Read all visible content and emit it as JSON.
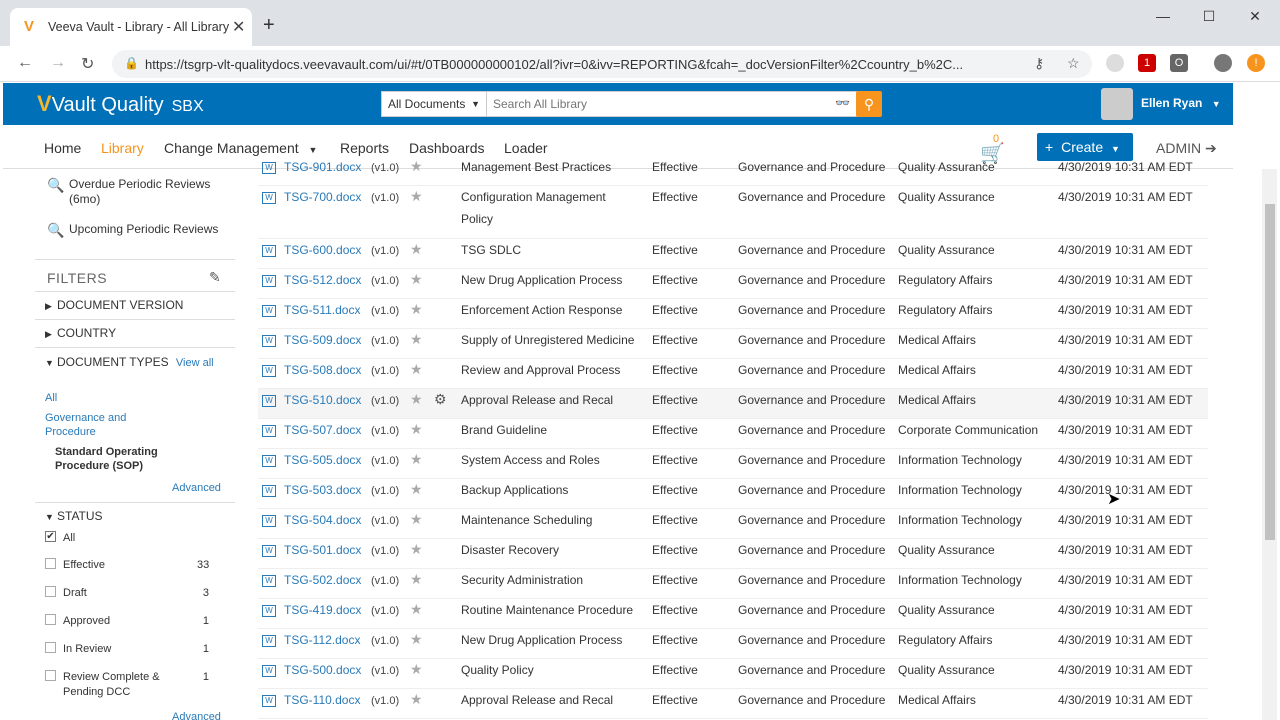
{
  "browser": {
    "tab_title": "Veeva Vault - Library - All Library",
    "url": "https://tsgrp-vlt-qualitydocs.veevavault.com/ui/#t/0TB000000000102/all?ivr=0&ivv=REPORTING&fcah=_docVersionFilter%2Ccountry_b%2C..."
  },
  "header": {
    "logo_text": "Vault Quality",
    "env_label": "SBX",
    "search_scope": "All Documents",
    "search_placeholder": "Search All Library",
    "user_name": "Ellen Ryan"
  },
  "nav": {
    "items": [
      "Home",
      "Library",
      "Change Management",
      "Reports",
      "Dashboards",
      "Loader"
    ],
    "active": "Library",
    "cart_count": "0",
    "create_label": "Create",
    "admin_label": "ADMIN"
  },
  "sidebar": {
    "saved_views": [
      "Overdue Periodic Reviews (6mo)",
      "Upcoming Periodic Reviews"
    ],
    "filters_label": "FILTERS",
    "facets": {
      "document_version": "DOCUMENT VERSION",
      "country": "COUNTRY",
      "document_types": "DOCUMENT TYPES",
      "view_all": "View all",
      "all": "All",
      "gov_proc": "Governance and Procedure",
      "sop": "Standard Operating Procedure (SOP)",
      "advanced": "Advanced",
      "status": "STATUS",
      "advanced2": "Advanced"
    },
    "status_options": [
      {
        "label": "All",
        "count": "",
        "checked": true
      },
      {
        "label": "Effective",
        "count": "33",
        "checked": false
      },
      {
        "label": "Draft",
        "count": "3",
        "checked": false
      },
      {
        "label": "Approved",
        "count": "1",
        "checked": false
      },
      {
        "label": "In Review",
        "count": "1",
        "checked": false
      },
      {
        "label": "Review Complete & Pending DCC",
        "count": "1",
        "checked": false
      }
    ]
  },
  "documents": [
    {
      "name": "TSG-901.docx",
      "version": "(v1.0)",
      "title": "Management Best Practices",
      "status": "Effective",
      "type": "Governance and Procedure",
      "dept": "Quality Assurance",
      "date": "4/30/2019 10:31 AM EDT"
    },
    {
      "name": "TSG-700.docx",
      "version": "(v1.0)",
      "title": "Configuration Management Policy",
      "status": "Effective",
      "type": "Governance and Procedure",
      "dept": "Quality Assurance",
      "date": "4/30/2019 10:31 AM EDT"
    },
    {
      "name": "TSG-600.docx",
      "version": "(v1.0)",
      "title": "TSG SDLC",
      "status": "Effective",
      "type": "Governance and Procedure",
      "dept": "Quality Assurance",
      "date": "4/30/2019 10:31 AM EDT"
    },
    {
      "name": "TSG-512.docx",
      "version": "(v1.0)",
      "title": "New Drug Application Process",
      "status": "Effective",
      "type": "Governance and Procedure",
      "dept": "Regulatory Affairs",
      "date": "4/30/2019 10:31 AM EDT"
    },
    {
      "name": "TSG-511.docx",
      "version": "(v1.0)",
      "title": "Enforcement Action Response",
      "status": "Effective",
      "type": "Governance and Procedure",
      "dept": "Regulatory Affairs",
      "date": "4/30/2019 10:31 AM EDT"
    },
    {
      "name": "TSG-509.docx",
      "version": "(v1.0)",
      "title": "Supply of Unregistered Medicine",
      "status": "Effective",
      "type": "Governance and Procedure",
      "dept": "Medical Affairs",
      "date": "4/30/2019 10:31 AM EDT"
    },
    {
      "name": "TSG-508.docx",
      "version": "(v1.0)",
      "title": "Review and Approval Process",
      "status": "Effective",
      "type": "Governance and Procedure",
      "dept": "Medical Affairs",
      "date": "4/30/2019 10:31 AM EDT"
    },
    {
      "name": "TSG-510.docx",
      "version": "(v1.0)",
      "title": "Approval Release and Recal",
      "status": "Effective",
      "type": "Governance and Procedure",
      "dept": "Medical Affairs",
      "date": "4/30/2019 10:31 AM EDT"
    },
    {
      "name": "TSG-507.docx",
      "version": "(v1.0)",
      "title": "Brand Guideline",
      "status": "Effective",
      "type": "Governance and Procedure",
      "dept": "Corporate Communication",
      "date": "4/30/2019 10:31 AM EDT"
    },
    {
      "name": "TSG-505.docx",
      "version": "(v1.0)",
      "title": "System Access and Roles",
      "status": "Effective",
      "type": "Governance and Procedure",
      "dept": "Information Technology",
      "date": "4/30/2019 10:31 AM EDT"
    },
    {
      "name": "TSG-503.docx",
      "version": "(v1.0)",
      "title": "Backup Applications",
      "status": "Effective",
      "type": "Governance and Procedure",
      "dept": "Information Technology",
      "date": "4/30/2019 10:31 AM EDT"
    },
    {
      "name": "TSG-504.docx",
      "version": "(v1.0)",
      "title": "Maintenance Scheduling",
      "status": "Effective",
      "type": "Governance and Procedure",
      "dept": "Information Technology",
      "date": "4/30/2019 10:31 AM EDT"
    },
    {
      "name": "TSG-501.docx",
      "version": "(v1.0)",
      "title": "Disaster Recovery",
      "status": "Effective",
      "type": "Governance and Procedure",
      "dept": "Quality Assurance",
      "date": "4/30/2019 10:31 AM EDT"
    },
    {
      "name": "TSG-502.docx",
      "version": "(v1.0)",
      "title": "Security Administration",
      "status": "Effective",
      "type": "Governance and Procedure",
      "dept": "Information Technology",
      "date": "4/30/2019 10:31 AM EDT"
    },
    {
      "name": "TSG-419.docx",
      "version": "(v1.0)",
      "title": "Routine Maintenance Procedure",
      "status": "Effective",
      "type": "Governance and Procedure",
      "dept": "Quality Assurance",
      "date": "4/30/2019 10:31 AM EDT"
    },
    {
      "name": "TSG-112.docx",
      "version": "(v1.0)",
      "title": "New Drug Application Process",
      "status": "Effective",
      "type": "Governance and Procedure",
      "dept": "Regulatory Affairs",
      "date": "4/30/2019 10:31 AM EDT"
    },
    {
      "name": "TSG-500.docx",
      "version": "(v1.0)",
      "title": "Quality Policy",
      "status": "Effective",
      "type": "Governance and Procedure",
      "dept": "Quality Assurance",
      "date": "4/30/2019 10:31 AM EDT"
    },
    {
      "name": "TSG-110.docx",
      "version": "(v1.0)",
      "title": "Approval Release and Recal",
      "status": "Effective",
      "type": "Governance and Procedure",
      "dept": "Medical Affairs",
      "date": "4/30/2019 10:31 AM EDT"
    }
  ],
  "colors": {
    "brand_blue": "#0070b8",
    "accent_orange": "#f7941d",
    "link_blue": "#2a7ab8"
  }
}
